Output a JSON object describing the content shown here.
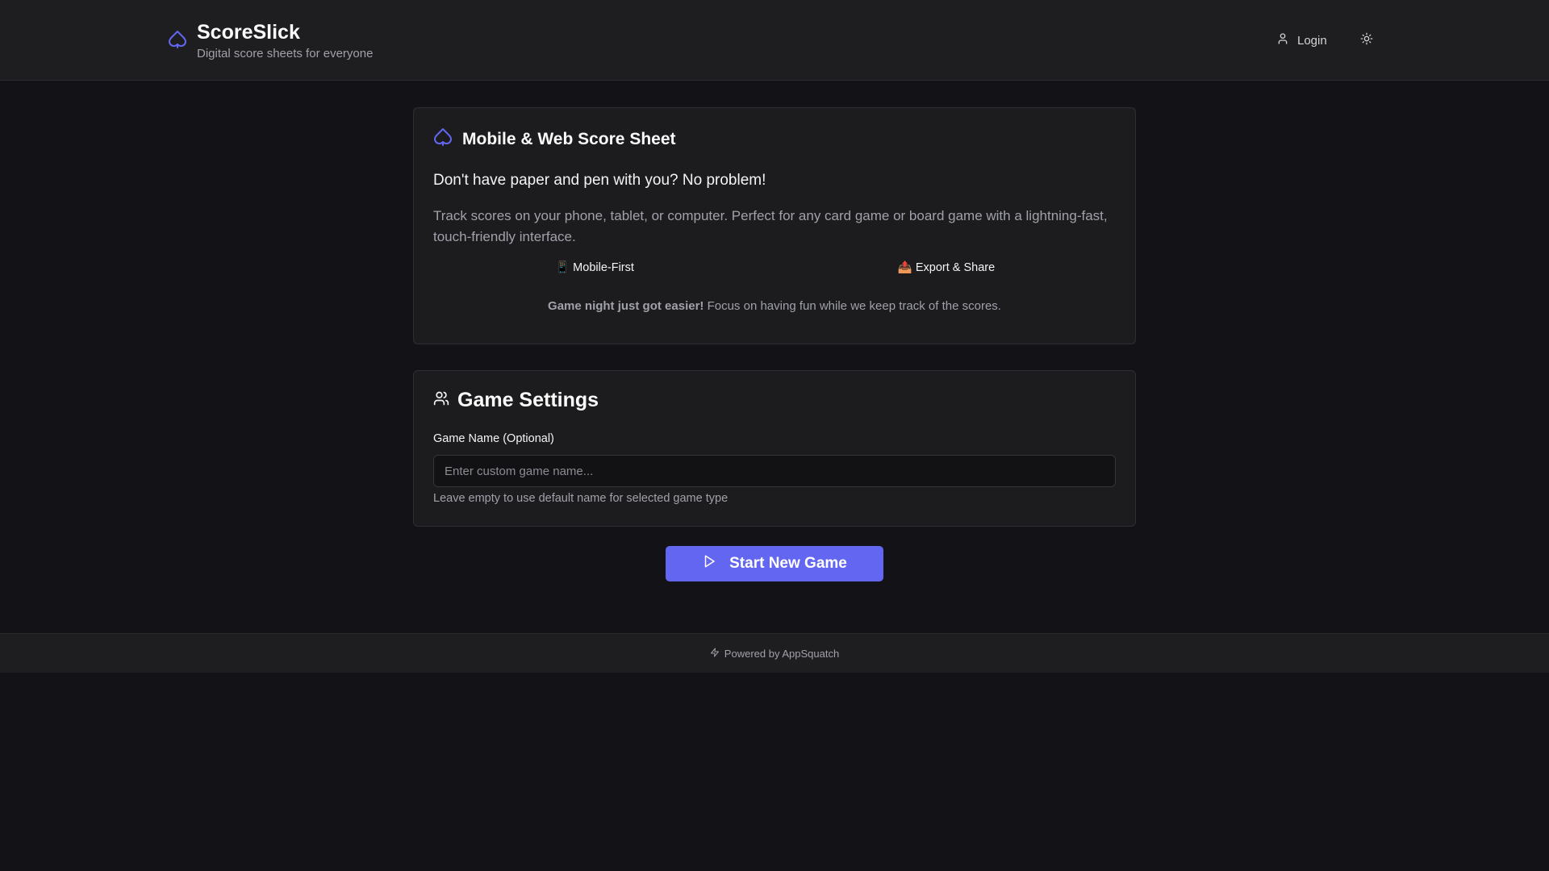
{
  "header": {
    "brand_title": "ScoreSlick",
    "brand_subtitle": "Digital score sheets for everyone",
    "login_label": "Login",
    "icons": {
      "brand": "spade-icon",
      "login": "user-icon",
      "theme": "sun-icon"
    }
  },
  "intro_card": {
    "title": "Mobile & Web Score Sheet",
    "lead": "Don't have paper and pen with you? No problem!",
    "description": "Track scores on your phone, tablet, or computer. Perfect for any card game or board game with a lightning-fast, touch-friendly interface.",
    "features": [
      {
        "label": "📱 Mobile-First"
      },
      {
        "label": "📤 Export & Share"
      }
    ],
    "tagline_bold": "Game night just got easier!",
    "tagline_rest": " Focus on having fun while we keep track of the scores."
  },
  "settings_card": {
    "title": "Game Settings",
    "game_name_label": "Game Name (Optional)",
    "game_name_value": "",
    "game_name_placeholder": "Enter custom game name...",
    "game_name_help": "Leave empty to use default name for selected game type"
  },
  "start_button": {
    "label": "Start New Game"
  },
  "footer": {
    "text": "Powered by AppSquatch"
  },
  "colors": {
    "background": "#121217",
    "surface": "#1c1c1f",
    "accent": "#6366f1",
    "muted_text": "#a1a1aa"
  }
}
